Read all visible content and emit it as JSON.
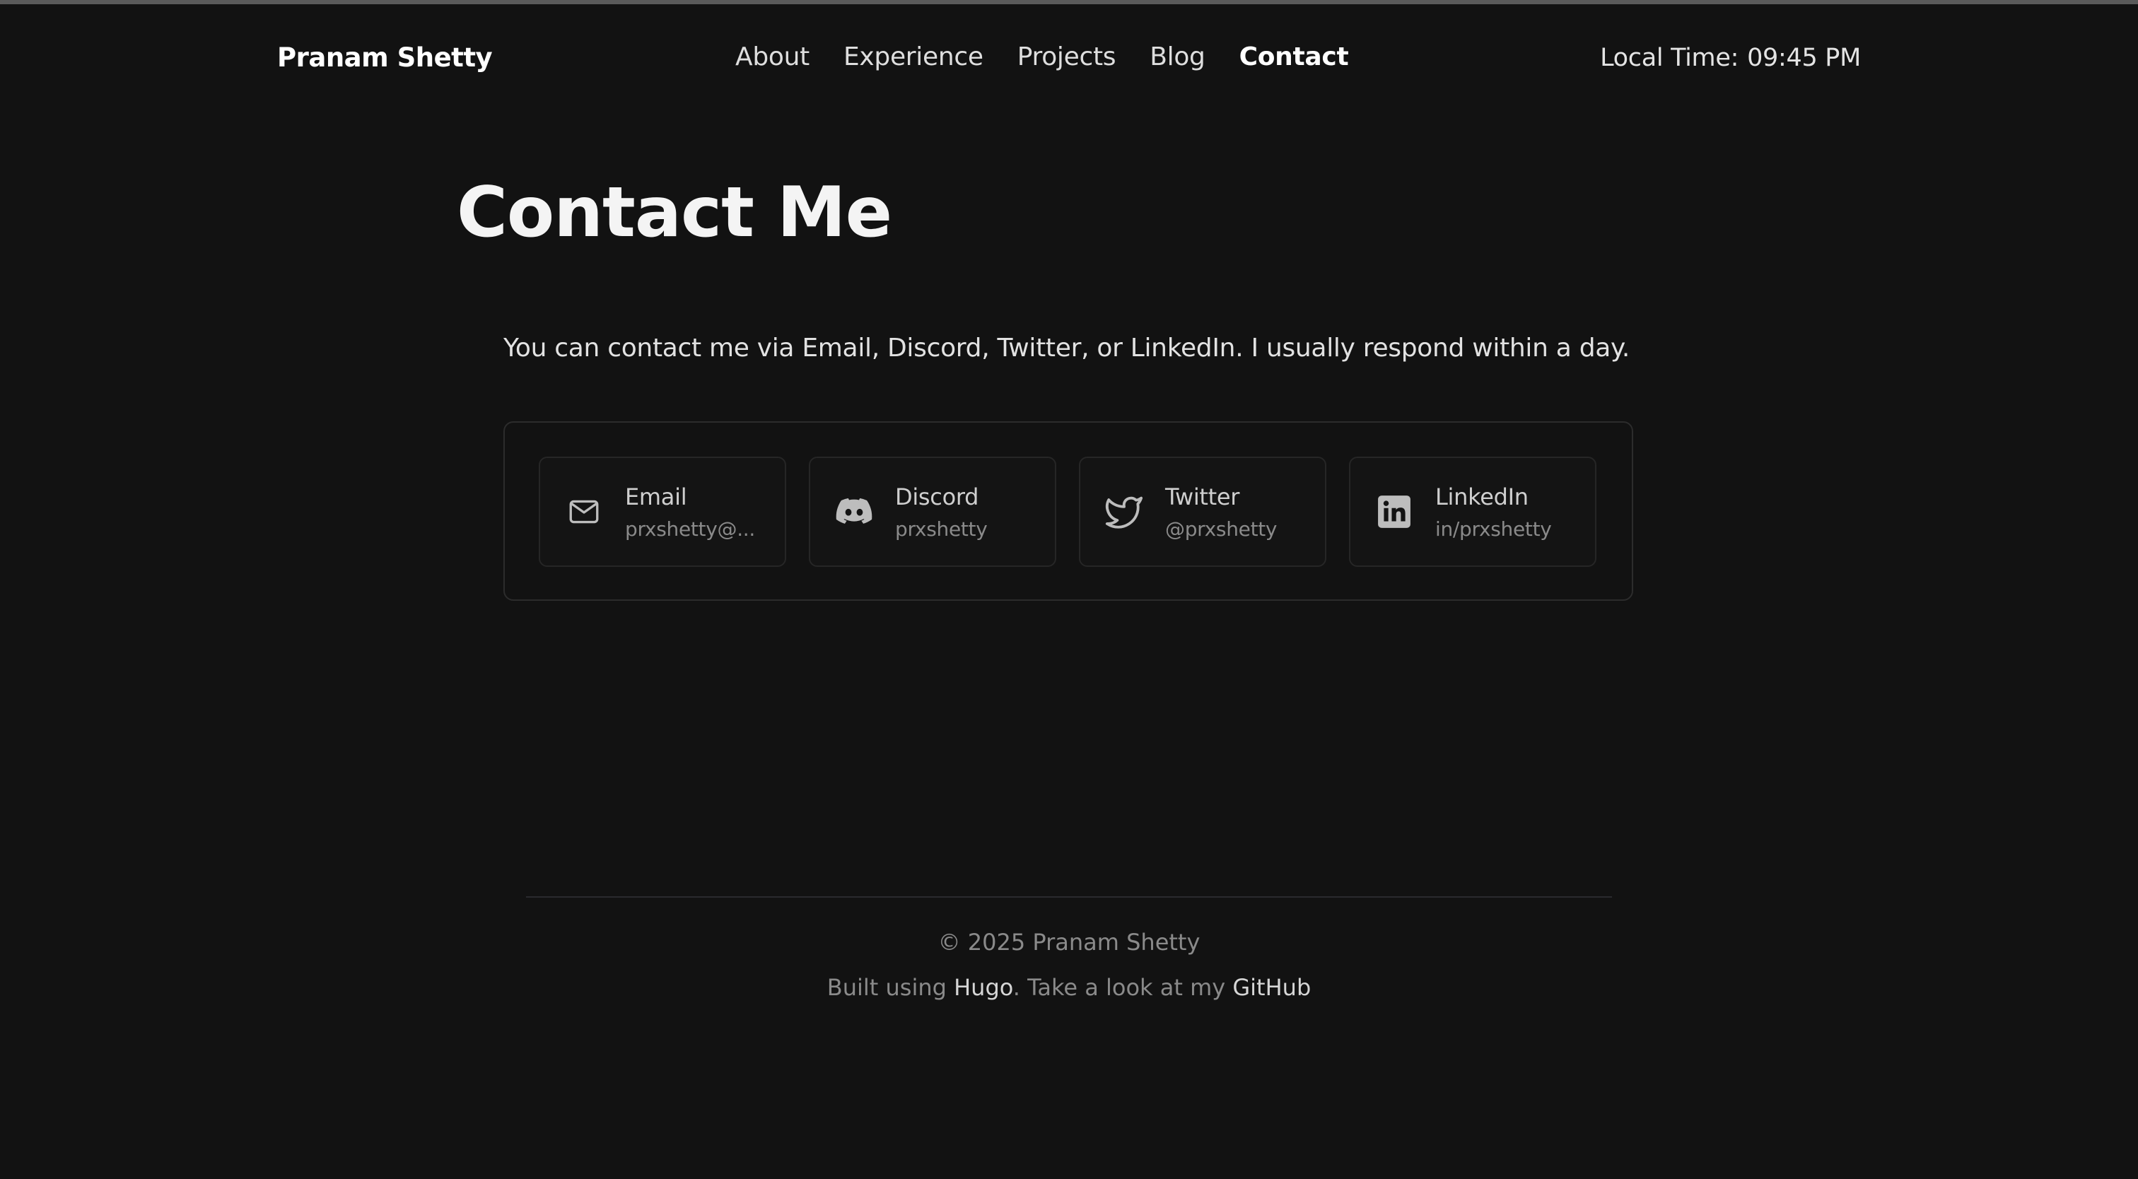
{
  "header": {
    "brand": "Pranam Shetty",
    "nav": [
      {
        "label": "About"
      },
      {
        "label": "Experience"
      },
      {
        "label": "Projects"
      },
      {
        "label": "Blog"
      },
      {
        "label": "Contact",
        "active": true
      }
    ],
    "local_time_label": "Local Time:",
    "local_time_value": "09:45 PM"
  },
  "main": {
    "title": "Contact Me",
    "intro": "You can contact me via Email, Discord, Twitter, or LinkedIn. I usually respond within a day.",
    "contacts": [
      {
        "label": "Email",
        "value": "prxshetty@...",
        "icon": "mail-icon"
      },
      {
        "label": "Discord",
        "value": "prxshetty",
        "icon": "discord-icon"
      },
      {
        "label": "Twitter",
        "value": "@prxshetty",
        "icon": "twitter-icon"
      },
      {
        "label": "LinkedIn",
        "value": "in/prxshetty",
        "icon": "linkedin-icon"
      }
    ]
  },
  "footer": {
    "copyright": "© 2025 Pranam Shetty",
    "built_prefix": "Built using ",
    "hugo_link": "Hugo",
    "built_middle": ". Take a look at my ",
    "github_link": "GitHub"
  },
  "colors": {
    "background": "#121212",
    "text": "#e8e8e8",
    "muted": "#8a8a8a",
    "border": "#2c2c2c"
  }
}
